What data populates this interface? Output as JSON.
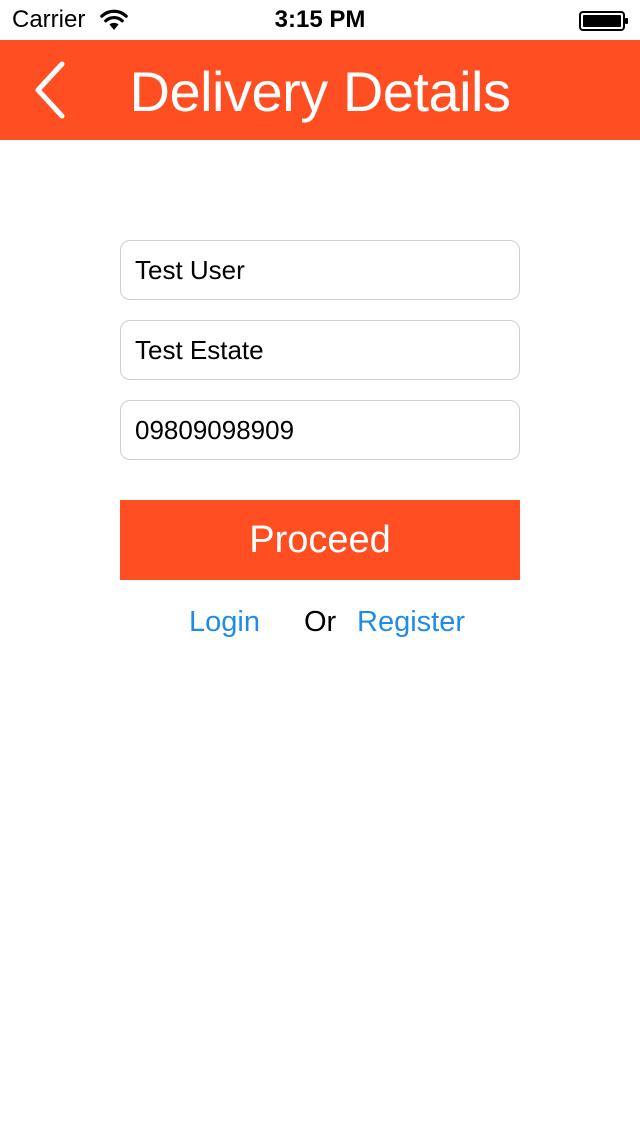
{
  "status_bar": {
    "carrier": "Carrier",
    "time": "3:15 PM"
  },
  "nav": {
    "title": "Delivery Details",
    "back_icon": "chevron-left-icon",
    "background_color": "#ff4e21"
  },
  "form": {
    "name_value": "Test User",
    "address_value": "Test Estate",
    "phone_value": "09809098909"
  },
  "actions": {
    "proceed_label": "Proceed",
    "login_label": "Login",
    "or_label": "Or",
    "register_label": "Register",
    "link_color": "#1f8ce8",
    "accent_color": "#ff4e21"
  }
}
